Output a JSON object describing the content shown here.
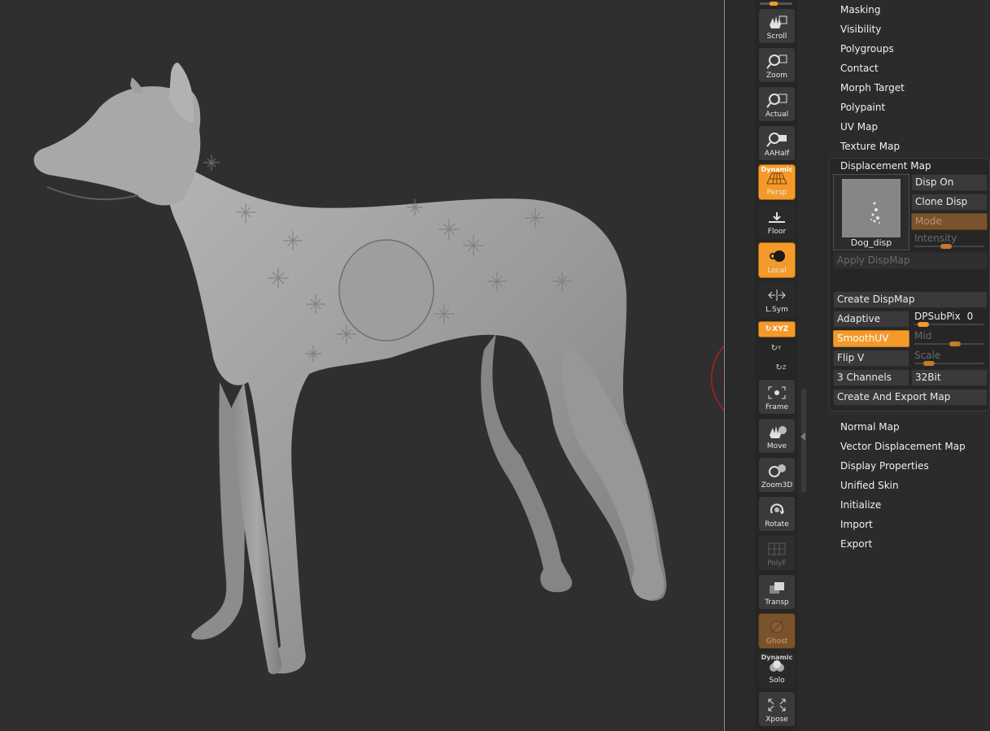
{
  "shelf": {
    "buttons": [
      {
        "label": "Scroll",
        "icon": "hand-scroll-icon"
      },
      {
        "label": "Zoom",
        "icon": "zoom-icon"
      },
      {
        "label": "Actual",
        "icon": "actual-size-icon"
      },
      {
        "label": "AAHalf",
        "icon": "aahalf-icon"
      },
      {
        "label": "Persp",
        "icon": "perspective-grid-icon",
        "badge": "Dynamic"
      },
      {
        "label": "Floor",
        "icon": "floor-icon"
      },
      {
        "label": "Local",
        "icon": "local-transform-icon"
      },
      {
        "label": "L.Sym",
        "icon": "local-symmetry-icon"
      },
      {
        "label": "Frame",
        "icon": "frame-icon"
      },
      {
        "label": "Move",
        "icon": "move-hand-icon"
      },
      {
        "label": "Zoom3D",
        "icon": "zoom3d-icon"
      },
      {
        "label": "Rotate",
        "icon": "rotate-icon"
      },
      {
        "label": "PolyF",
        "icon": "polyframe-grid-icon"
      },
      {
        "label": "Transp",
        "icon": "transparency-icon"
      },
      {
        "label": "Ghost",
        "icon": "ghost-icon"
      },
      {
        "label": "Solo",
        "icon": "solo-spheres-icon",
        "badge": "Dynamic"
      },
      {
        "label": "Xpose",
        "icon": "xpose-icon"
      }
    ],
    "xyz_label": "XYZ",
    "y_label": "Y",
    "z_label": "Z"
  },
  "menu": {
    "top": [
      "Masking",
      "Visibility",
      "Polygroups",
      "Contact",
      "Morph Target",
      "Polypaint",
      "UV Map",
      "Texture Map",
      "Displacement Map"
    ],
    "bottom": [
      "Normal Map",
      "Vector Displacement Map",
      "Display Properties",
      "Unified Skin",
      "Initialize",
      "Import",
      "Export"
    ]
  },
  "displacement": {
    "thumb_label": "Dog_disp",
    "disp_on": "Disp On",
    "clone_disp": "Clone Disp",
    "mode": "Mode",
    "intensity": {
      "label": "Intensity",
      "value": 0.45
    },
    "apply_dispmap": "Apply DispMap",
    "create_dispmap": "Create DispMap",
    "adaptive": "Adaptive",
    "dpsubpix": {
      "label": "DPSubPix",
      "value": "0",
      "level": 0.05
    },
    "smooth_uv": "SmoothUV",
    "mid": {
      "label": "Mid",
      "value": 0.6
    },
    "flip_v": "Flip V",
    "scale": {
      "label": "Scale",
      "value": 0.15
    },
    "channels": "3 Channels",
    "bit": "32Bit",
    "create_export": "Create And Export Map"
  },
  "colors": {
    "accent": "#f39a2a",
    "ghost": "#7a522c",
    "panel": "#2b2b2b"
  }
}
